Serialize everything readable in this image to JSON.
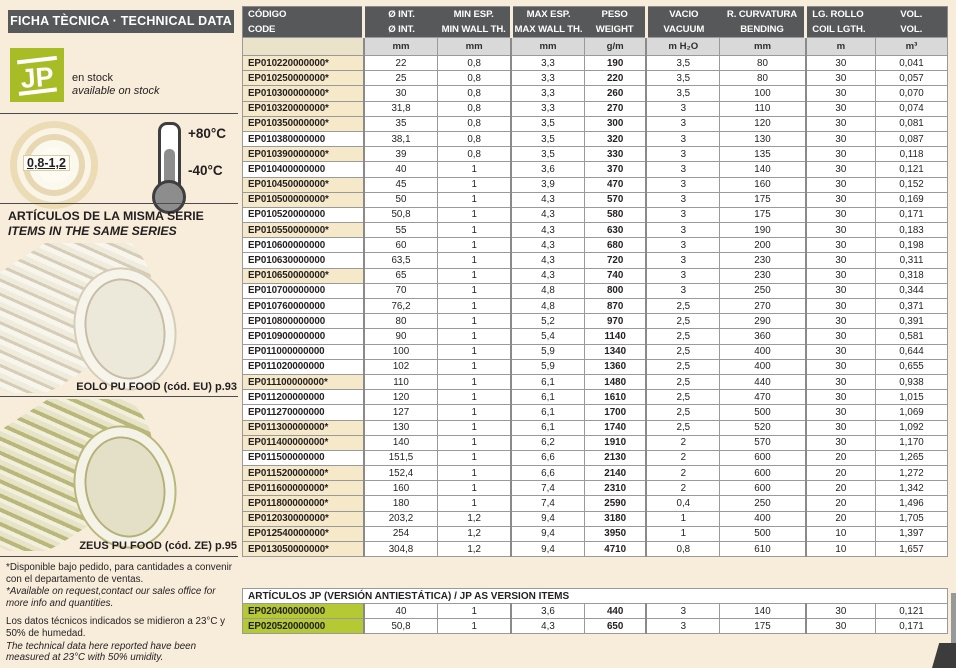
{
  "left_panel": {
    "title": "FICHA TÈCNICA · TECHNICAL DATA",
    "logo_text": "JP",
    "stock_es": "en stock",
    "stock_en": "available on stock",
    "wall_badge": "0,8-1,2",
    "temp_max": "+80°C",
    "temp_min": "-40°C",
    "series_title_es": "ARTÍCULOS DE LA MISMA SERIE",
    "series_title_en": "ITEMS IN THE SAME SERIES",
    "related_item_1": "EOLO PU FOOD (cód. EU) p.93",
    "related_item_2": "ZEUS PU FOOD (cód. ZE) p.95",
    "footnote_request_es": "*Disponible bajo pedido, para cantidades a convenir con el departamento de ventas.",
    "footnote_request_en": "*Available on request,contact our sales office for more info and quantities.",
    "footnote_data_es": "Los datos técnicos indicados se midieron a 23°C y 50% de humedad.",
    "footnote_data_en": "The technical data here reported have been measured at 23°C with 50% umidity."
  },
  "colors": {
    "page_background": "#f8eddb",
    "header_gray": "#57585a",
    "highlight_beige": "#f6e9c9",
    "units_gray": "#d9d9d9",
    "brand_green": "#a8bc25",
    "antistatic_green": "#b4c933"
  },
  "table": {
    "headers_row1": [
      "CÓDIGO",
      "Ø INT.",
      "MIN ESP.",
      "MAX ESP.",
      "PESO",
      "VACIO",
      "R. CURVATURA",
      "LG. ROLLO",
      "VOL."
    ],
    "headers_row2": [
      "CODE",
      "Ø INT.",
      "MIN WALL TH.",
      "MAX WALL TH.",
      "WEIGHT",
      "VACUUM",
      "BENDING",
      "COIL LGTH.",
      "VOL."
    ],
    "units": [
      "",
      "mm",
      "mm",
      "mm",
      "g/m",
      "m H₂O",
      "mm",
      "m",
      "m³"
    ],
    "rows": [
      [
        "EP010220000000*",
        "22",
        "0,8",
        "3,3",
        "190",
        "3,5",
        "80",
        "30",
        "0,041"
      ],
      [
        "EP010250000000*",
        "25",
        "0,8",
        "3,3",
        "220",
        "3,5",
        "80",
        "30",
        "0,057"
      ],
      [
        "EP010300000000*",
        "30",
        "0,8",
        "3,3",
        "260",
        "3,5",
        "100",
        "30",
        "0,070"
      ],
      [
        "EP010320000000*",
        "31,8",
        "0,8",
        "3,3",
        "270",
        "3",
        "110",
        "30",
        "0,074"
      ],
      [
        "EP010350000000*",
        "35",
        "0,8",
        "3,5",
        "300",
        "3",
        "120",
        "30",
        "0,081"
      ],
      [
        "EP010380000000",
        "38,1",
        "0,8",
        "3,5",
        "320",
        "3",
        "130",
        "30",
        "0,087"
      ],
      [
        "EP010390000000*",
        "39",
        "0,8",
        "3,5",
        "330",
        "3",
        "135",
        "30",
        "0,118"
      ],
      [
        "EP010400000000",
        "40",
        "1",
        "3,6",
        "370",
        "3",
        "140",
        "30",
        "0,121"
      ],
      [
        "EP010450000000*",
        "45",
        "1",
        "3,9",
        "470",
        "3",
        "160",
        "30",
        "0,152"
      ],
      [
        "EP010500000000*",
        "50",
        "1",
        "4,3",
        "570",
        "3",
        "175",
        "30",
        "0,169"
      ],
      [
        "EP010520000000",
        "50,8",
        "1",
        "4,3",
        "580",
        "3",
        "175",
        "30",
        "0,171"
      ],
      [
        "EP010550000000*",
        "55",
        "1",
        "4,3",
        "630",
        "3",
        "190",
        "30",
        "0,183"
      ],
      [
        "EP010600000000",
        "60",
        "1",
        "4,3",
        "680",
        "3",
        "200",
        "30",
        "0,198"
      ],
      [
        "EP010630000000",
        "63,5",
        "1",
        "4,3",
        "720",
        "3",
        "230",
        "30",
        "0,311"
      ],
      [
        "EP010650000000*",
        "65",
        "1",
        "4,3",
        "740",
        "3",
        "230",
        "30",
        "0,318"
      ],
      [
        "EP010700000000",
        "70",
        "1",
        "4,8",
        "800",
        "3",
        "250",
        "30",
        "0,344"
      ],
      [
        "EP010760000000",
        "76,2",
        "1",
        "4,8",
        "870",
        "2,5",
        "270",
        "30",
        "0,371"
      ],
      [
        "EP010800000000",
        "80",
        "1",
        "5,2",
        "970",
        "2,5",
        "290",
        "30",
        "0,391"
      ],
      [
        "EP010900000000",
        "90",
        "1",
        "5,4",
        "1140",
        "2,5",
        "360",
        "30",
        "0,581"
      ],
      [
        "EP011000000000",
        "100",
        "1",
        "5,9",
        "1340",
        "2,5",
        "400",
        "30",
        "0,644"
      ],
      [
        "EP011020000000",
        "102",
        "1",
        "5,9",
        "1360",
        "2,5",
        "400",
        "30",
        "0,655"
      ],
      [
        "EP011100000000*",
        "110",
        "1",
        "6,1",
        "1480",
        "2,5",
        "440",
        "30",
        "0,938"
      ],
      [
        "EP011200000000",
        "120",
        "1",
        "6,1",
        "1610",
        "2,5",
        "470",
        "30",
        "1,015"
      ],
      [
        "EP011270000000",
        "127",
        "1",
        "6,1",
        "1700",
        "2,5",
        "500",
        "30",
        "1,069"
      ],
      [
        "EP011300000000*",
        "130",
        "1",
        "6,1",
        "1740",
        "2,5",
        "520",
        "30",
        "1,092"
      ],
      [
        "EP011400000000*",
        "140",
        "1",
        "6,2",
        "1910",
        "2",
        "570",
        "30",
        "1,170"
      ],
      [
        "EP011500000000",
        "151,5",
        "1",
        "6,6",
        "2130",
        "2",
        "600",
        "20",
        "1,265"
      ],
      [
        "EP011520000000*",
        "152,4",
        "1",
        "6,6",
        "2140",
        "2",
        "600",
        "20",
        "1,272"
      ],
      [
        "EP011600000000*",
        "160",
        "1",
        "7,4",
        "2310",
        "2",
        "600",
        "20",
        "1,342"
      ],
      [
        "EP011800000000*",
        "180",
        "1",
        "7,4",
        "2590",
        "0,4",
        "250",
        "20",
        "1,496"
      ],
      [
        "EP012030000000*",
        "203,2",
        "1,2",
        "9,4",
        "3180",
        "1",
        "400",
        "20",
        "1,705"
      ],
      [
        "EP012540000000*",
        "254",
        "1,2",
        "9,4",
        "3950",
        "1",
        "500",
        "10",
        "1,397"
      ],
      [
        "EP013050000000*",
        "304,8",
        "1,2",
        "9,4",
        "4710",
        "0,8",
        "610",
        "10",
        "1,657"
      ]
    ]
  },
  "antistatic": {
    "title": "ARTÍCULOS JP (VERSIÓN ANTIESTÁTICA) / JP AS VERSION ITEMS",
    "rows": [
      [
        "EP020400000000",
        "40",
        "1",
        "3,6",
        "440",
        "3",
        "140",
        "30",
        "0,121"
      ],
      [
        "EP020520000000",
        "50,8",
        "1",
        "4,3",
        "650",
        "3",
        "175",
        "30",
        "0,171"
      ]
    ]
  }
}
